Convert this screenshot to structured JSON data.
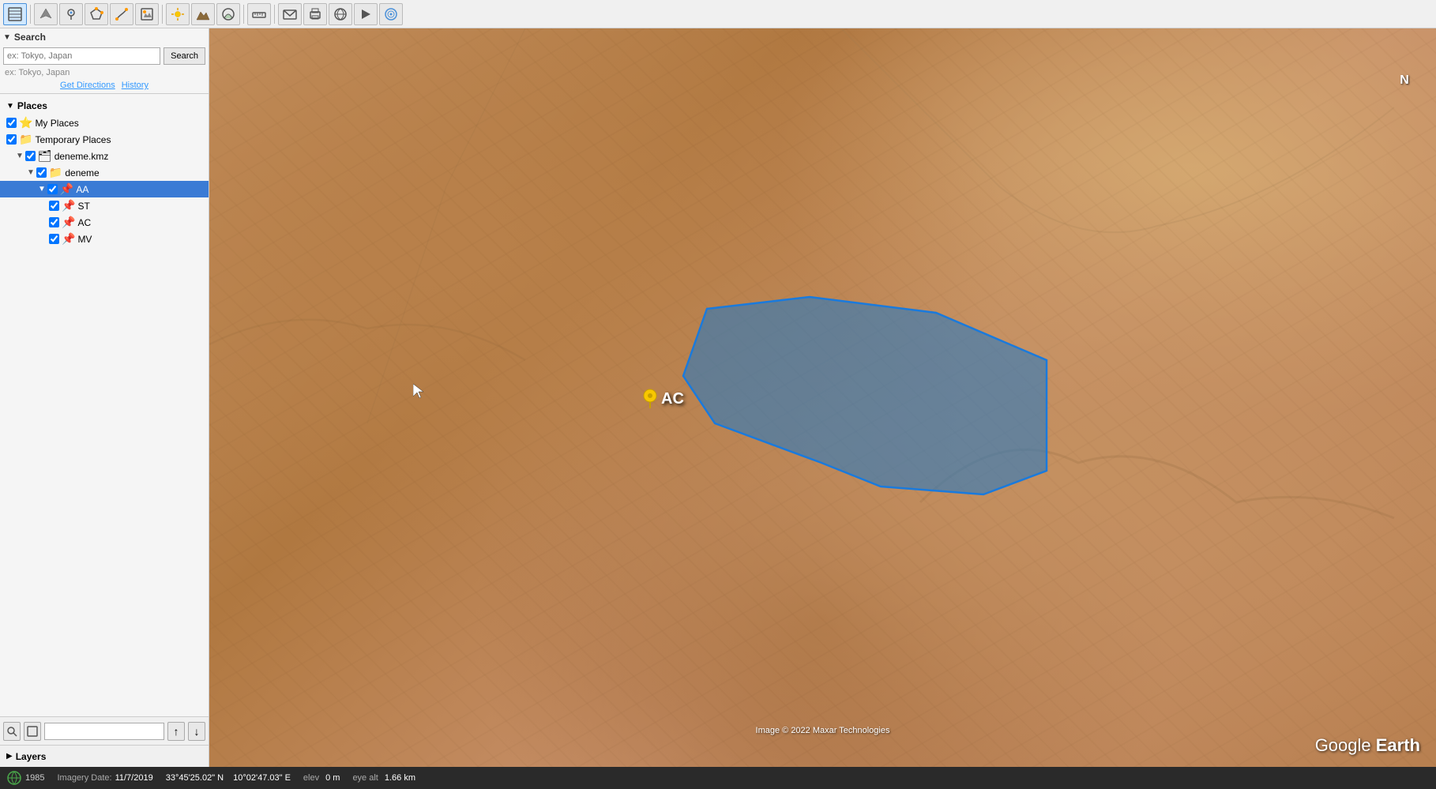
{
  "toolbar": {
    "buttons": [
      {
        "id": "globe-view",
        "icon": "🌐",
        "active": true,
        "label": "Globe View"
      },
      {
        "id": "fly-to",
        "icon": "✈",
        "active": false,
        "label": "Fly To"
      },
      {
        "id": "add-placemark",
        "icon": "📍",
        "active": false,
        "label": "Add Placemark"
      },
      {
        "id": "add-polygon",
        "icon": "⬡",
        "active": false,
        "label": "Add Polygon"
      },
      {
        "id": "add-path",
        "icon": "〰",
        "active": false,
        "label": "Add Path"
      },
      {
        "id": "measure",
        "icon": "📐",
        "active": false,
        "label": "Measure"
      },
      {
        "id": "sun",
        "icon": "☀",
        "active": false,
        "label": "Sun"
      },
      {
        "id": "terrain",
        "icon": "⛰",
        "active": false,
        "label": "Terrain"
      },
      {
        "id": "sky",
        "icon": "🌙",
        "active": false,
        "label": "Sky"
      },
      {
        "id": "ruler",
        "icon": "📏",
        "active": false,
        "label": "Ruler"
      },
      {
        "id": "email",
        "icon": "✉",
        "active": false,
        "label": "Email"
      },
      {
        "id": "print",
        "icon": "🖨",
        "active": false,
        "label": "Print"
      },
      {
        "id": "kml",
        "icon": "📄",
        "active": false,
        "label": "KML"
      },
      {
        "id": "movie",
        "icon": "🎬",
        "active": false,
        "label": "Movie"
      },
      {
        "id": "layers-btn",
        "icon": "🗂",
        "active": false,
        "label": "Layers Button"
      }
    ]
  },
  "search": {
    "header": "Search",
    "arrow": "▼",
    "placeholder": "ex: Tokyo, Japan",
    "search_button": "Search",
    "get_directions": "Get Directions",
    "history": "History"
  },
  "places": {
    "header": "Places",
    "arrow": "▼",
    "items": [
      {
        "id": "my-places",
        "label": "My Places",
        "level": 0,
        "icon": "⭐",
        "checked": true,
        "arrow": ""
      },
      {
        "id": "temp-places",
        "label": "Temporary Places",
        "level": 0,
        "icon": "📁",
        "checked": true,
        "arrow": ""
      },
      {
        "id": "deneme-kmz",
        "label": "deneme.kmz",
        "level": 1,
        "icon": "🗂",
        "checked": true,
        "arrow": "▼"
      },
      {
        "id": "deneme",
        "label": "deneme",
        "level": 2,
        "icon": "📁",
        "checked": true,
        "arrow": "▼"
      },
      {
        "id": "aa",
        "label": "AA",
        "level": 3,
        "icon": "📌",
        "checked": true,
        "arrow": "▼",
        "selected": true
      },
      {
        "id": "st",
        "label": "ST",
        "level": 4,
        "icon": "📌",
        "checked": true,
        "arrow": ""
      },
      {
        "id": "ac",
        "label": "AC",
        "level": 4,
        "icon": "📌",
        "checked": true,
        "arrow": ""
      },
      {
        "id": "mv",
        "label": "MV",
        "level": 4,
        "icon": "📌",
        "checked": true,
        "arrow": ""
      }
    ]
  },
  "sidebar_bottom": {
    "search_icon": "🔍",
    "layers_icon": "⬛",
    "up_arrow": "↑",
    "down_arrow": "↓"
  },
  "layers": {
    "arrow": "▶",
    "label": "Layers"
  },
  "map": {
    "north_label": "N",
    "copyright": "Image © 2022 Maxar Technologies",
    "google_earth": "Google Earth",
    "ac_label": "AC",
    "cursor_x": "558",
    "cursor_y": "475"
  },
  "status_bar": {
    "year": "1985",
    "imagery_date_label": "Imagery Date:",
    "imagery_date": "11/7/2019",
    "lat_label": "33°45'25.02\" N",
    "lon_label": "10°02'47.03\" E",
    "elev_label": "elev",
    "elev_value": "0 m",
    "eye_alt_label": "eye alt",
    "eye_alt_value": "1.66 km"
  }
}
